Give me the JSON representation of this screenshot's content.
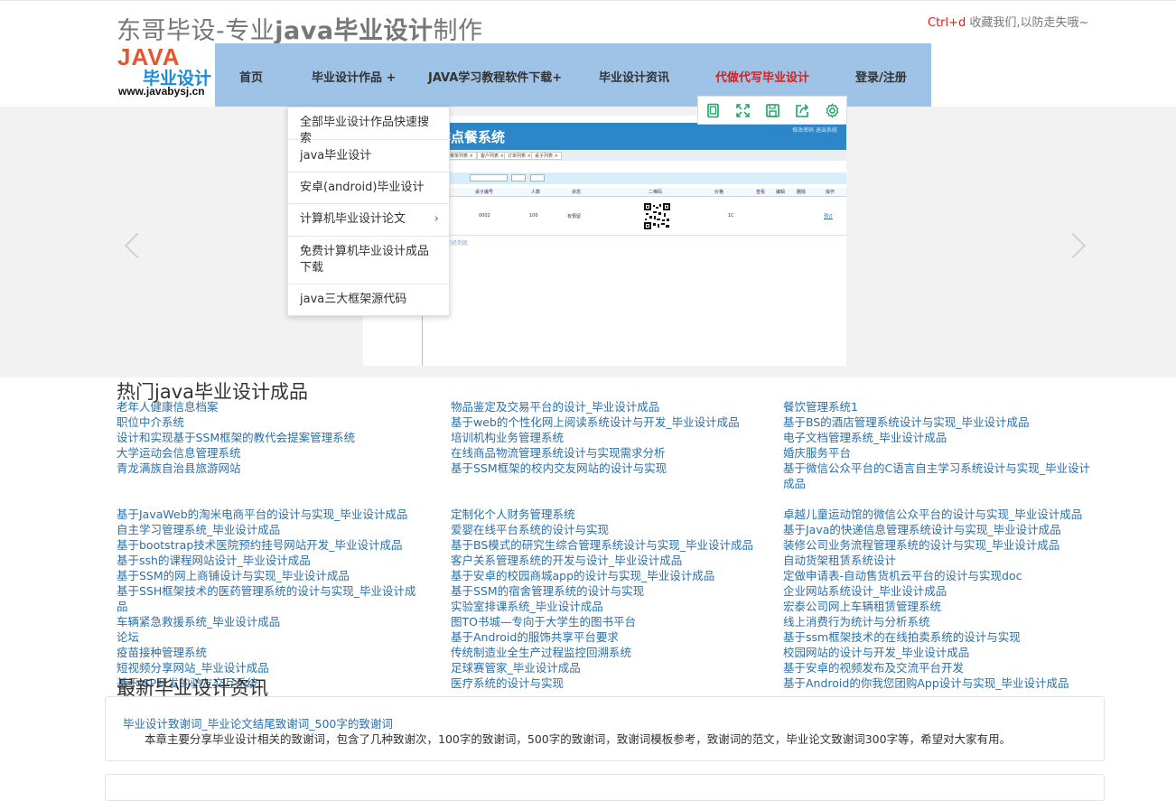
{
  "header": {
    "title_prefix": "东哥毕设-专业",
    "title_bold": "java毕业设计",
    "title_suffix": "制作",
    "fav_key": "Ctrl+d",
    "fav_text": " 收藏我们,以防走失哦~",
    "logo_line1": "JAVA",
    "logo_line2": "毕业设计",
    "logo_line3": "www.javabysj.cn"
  },
  "nav": {
    "items": [
      "首页",
      "毕业设计作品 +",
      "JAVA学习教程软件下载+",
      "毕业设计资讯",
      "代做代写毕业设计",
      "登录/注册"
    ]
  },
  "dropdown": {
    "items": [
      "全部毕业设计作品快速搜索",
      "java毕业设计",
      "安卓(android)毕业设计",
      "计算机毕业设计论文",
      "免费计算机毕业设计成品下载",
      "java三大框架源代码"
    ],
    "submenu_glyph": "›"
  },
  "slide": {
    "title": "作点餐系统",
    "header_links": "修改密码  退出系统",
    "tabs": [
      "菜单列表 ×",
      "客户列表 ×",
      "订单列表 ×",
      "桌子列表 ×"
    ],
    "columns": [
      "桌子编号",
      "人数",
      "状态",
      "二维码",
      "价格",
      "查看",
      "编辑",
      "删除",
      "操作"
    ],
    "row": [
      "0002",
      "100",
      "有預留",
      "",
      "1C",
      "",
      "",
      "",
      "预订"
    ],
    "footer": "已经到底"
  },
  "toolbar": {
    "icons": [
      "copy-icon",
      "fullscreen-icon",
      "save-icon",
      "share-icon",
      "settings-icon"
    ]
  },
  "hot": {
    "heading": "热门java毕业设计成品",
    "col1a": [
      "老年人健康信息档案",
      "职位中介系统",
      "设计和实现基于SSM框架的教代会提案管理系统",
      "大学运动会信息管理系统",
      "青龙满族自治县旅游网站"
    ],
    "col1b": [
      "基于JavaWeb的淘米电商平台的设计与实现_毕业设计成品",
      "自主学习管理系统_毕业设计成品",
      "基于bootstrap技术医院预约挂号网站开发_毕业设计成品",
      "基于ssh的课程网站设计_毕业设计成品",
      "基于SSM的网上商铺设计与实现_毕业设计成品",
      "基于SSH框架技术的医药管理系统的设计与实现_毕业设计成品",
      "车辆紧急救援系统_毕业设计成品",
      "论坛",
      "疫苗接种管理系统",
      "短视频分享网站_毕业设计成品",
      "基于JSP开发的驴友交互系统"
    ],
    "col2a": [
      "物品鉴定及交易平台的设计_毕业设计成品",
      "基于web的个性化网上阅读系统设计与开发_毕业设计成品",
      "培训机构业务管理系统",
      "在线商品物流管理系统设计与实现需求分析",
      "基于SSM框架的校内交友网站的设计与实现"
    ],
    "col2b": [
      "定制化个人财务管理系统",
      "爱婴在线平台系统的设计与实现",
      "基于BS模式的研究生综合管理系统设计与实现_毕业设计成品",
      "客户关系管理系统的开发与设计_毕业设计成品",
      "基于安卓的校园商城app的设计与实现_毕业设计成品",
      "基于SSM的宿舍管理系统的设计与实现",
      "实验室排课系统_毕业设计成品",
      "图TO书城—专向于大学生的图书平台",
      "基于Android的服饰共享平台要求",
      "传统制造业全生产过程监控回溯系统",
      "足球赛管家_毕业设计成品",
      "医疗系统的设计与实现"
    ],
    "col3a": [
      "餐饮管理系统1",
      "基于BS的酒店管理系统设计与实现_毕业设计成品",
      "电子文档管理系统_毕业设计成品",
      "婚庆服务平台",
      "基于微信公众平台的C语言自主学习系统设计与实现_毕业设计成品"
    ],
    "col3b": [
      "卓越儿童运动馆的微信公众平台的设计与实现_毕业设计成品",
      "基于Java的快递信息管理系统设计与实现_毕业设计成品",
      "装修公司业务流程管理系统的设计与实现_毕业设计成品",
      "自动货架租赁系统设计",
      "定做申请表-自动售货机云平台的设计与实现doc",
      "企业网站系统设计_毕业设计成品",
      "宏泰公司网上车辆租赁管理系统",
      "线上消费行为统计与分析系统",
      "基于ssm框架技术的在线拍卖系统的设计与实现",
      "校园网站的设计与开发_毕业设计成品",
      "基于安卓的视频发布及交流平台开发",
      "基于Android的你我您团购App设计与实现_毕业设计成品"
    ]
  },
  "news": {
    "heading": "最新毕业设计资讯",
    "item_title": "毕业设计致谢词_毕业论文结尾致谢词_500字的致谢词",
    "item_desc": "本章主要分享毕业设计相关的致谢词，包含了几种致谢次，100字的致谢词，500字的致谢词，致谢词模板参考，致谢词的范文，毕业论文致谢词300字等，希望对大家有用。"
  },
  "colors": {
    "nav_bg": "#9ec3e6",
    "link": "#2b6fa8",
    "hot_nav": "#e01a1a",
    "toolbar_icon": "#19a563"
  }
}
